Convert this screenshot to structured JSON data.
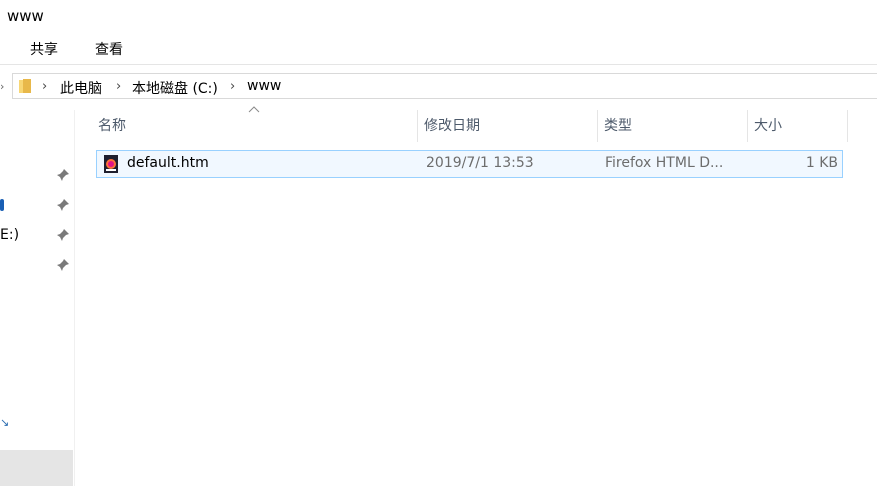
{
  "window": {
    "title": "www"
  },
  "ribbon": {
    "tabs": [
      {
        "label": "共享"
      },
      {
        "label": "查看"
      }
    ]
  },
  "address": {
    "crumbs": [
      {
        "label": "此电脑"
      },
      {
        "label": "本地磁盘 (C:)"
      },
      {
        "label": "www"
      }
    ]
  },
  "nav": {
    "fragments": [
      {
        "label": "E:)"
      }
    ]
  },
  "columns": {
    "name": "名称",
    "date": "修改日期",
    "type": "类型",
    "size": "大小"
  },
  "files": [
    {
      "name": "default.htm",
      "date": "2019/7/1 13:53",
      "type": "Firefox HTML D...",
      "size": "1 KB",
      "icon": "firefox-html-file-icon"
    }
  ],
  "colors": {
    "selection_border": "#99d1ff",
    "selection_fill": "#e5f3ff",
    "header_text": "#4d5a6b",
    "meta_text": "#6d6d6d",
    "folder_yellow": "#f8d775"
  }
}
